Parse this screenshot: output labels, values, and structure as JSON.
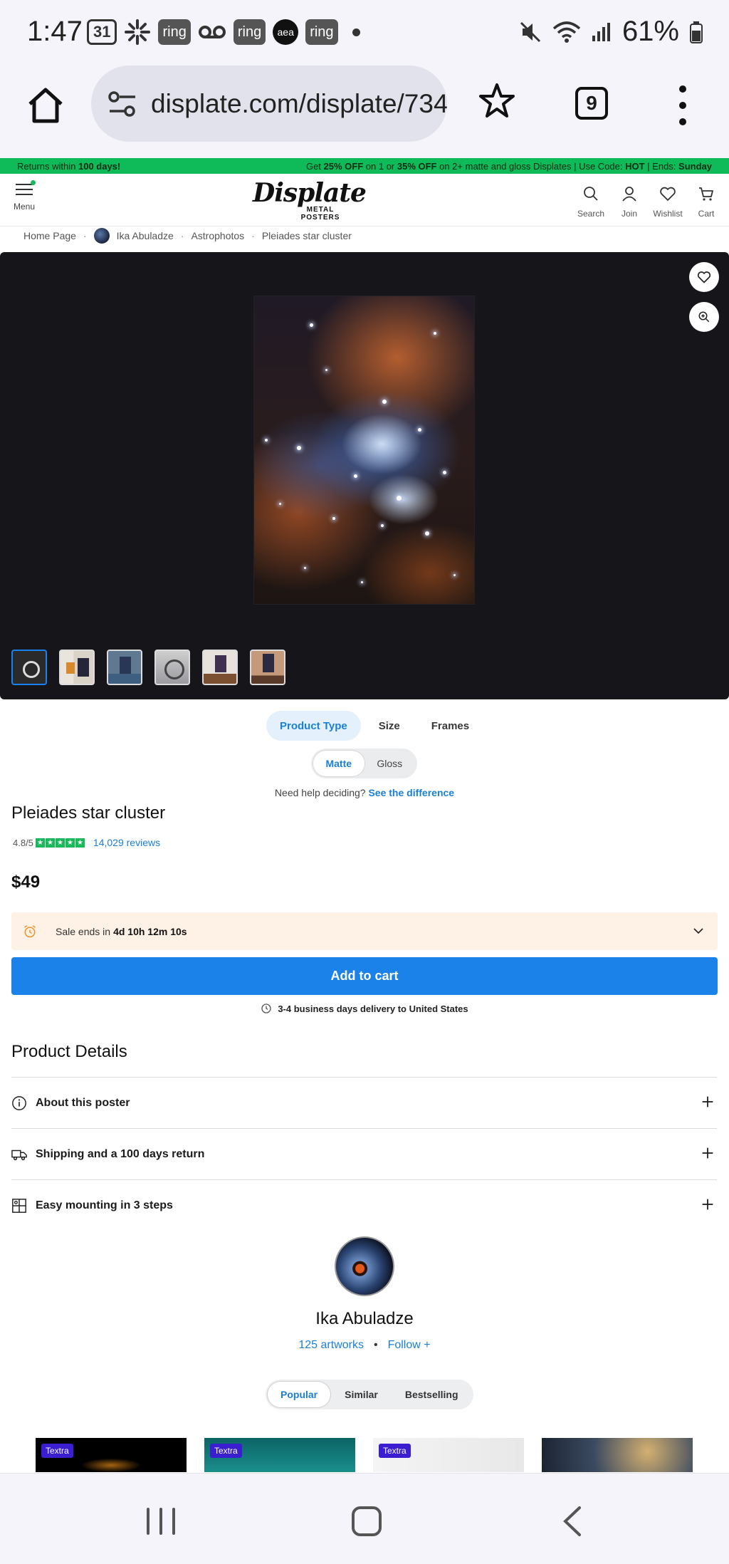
{
  "status_bar": {
    "time": "1:47",
    "calendar_day": "31",
    "left_icons": [
      "calendar-icon",
      "pinwheel-icon",
      "ring-icon",
      "voicemail-icon",
      "ring-icon",
      "amazon-icon",
      "ring-icon",
      "dot-icon"
    ],
    "ring_label": "ring",
    "amazon_label": "aea",
    "battery": "61%"
  },
  "browser": {
    "url": "displate.com/displate/734",
    "tab_count": "9"
  },
  "promo": {
    "left_prefix": "Returns within ",
    "left_bold": "100 days!",
    "right_1": "Get ",
    "right_2": "25% OFF",
    "right_3": " on 1 or ",
    "right_4": "35% OFF",
    "right_5": " on 2+ matte and gloss Displates | Use Code: ",
    "right_6": "HOT",
    "right_7": " | Ends: ",
    "right_8": "Sunday"
  },
  "header": {
    "menu_label": "Menu",
    "logo_text": "Displate",
    "logo_sub": "METAL POSTERS",
    "actions": {
      "search": "Search",
      "join": "Join",
      "wishlist": "Wishlist",
      "cart": "Cart"
    }
  },
  "breadcrumb": {
    "home": "Home Page",
    "artist": "Ika Abuladze",
    "category": "Astrophotos",
    "current": "Pleiades star cluster"
  },
  "options": {
    "tabs": [
      "Product Type",
      "Size",
      "Frames"
    ],
    "active_tab": "Product Type",
    "finishes": [
      "Matte",
      "Gloss"
    ],
    "active_finish": "Matte",
    "help_text": "Need help deciding? ",
    "help_link": "See the difference"
  },
  "product": {
    "title": "Pleiades star cluster",
    "rating": "4.8/5",
    "star_count": 5,
    "reviews": "14,029 reviews",
    "price": "$49",
    "sale_label": "Sale ends in",
    "sale_countdown": "4d 10h 12m 10s",
    "add_to_cart": "Add to cart",
    "delivery": "3-4 business days delivery to United States"
  },
  "details": {
    "title": "Product Details",
    "items": [
      "About this poster",
      "Shipping and a 100 days return",
      "Easy mounting in 3 steps"
    ]
  },
  "artist": {
    "name": "Ika Abuladze",
    "artworks": "125 artworks",
    "dot": "•",
    "follow": "Follow +",
    "tabs": [
      "Popular",
      "Similar",
      "Bestselling"
    ],
    "active_tab": "Popular",
    "card_tag": "Textra"
  },
  "colors": {
    "accent_blue": "#1a82e8",
    "promo_green": "#0fbb58",
    "rating_green": "#19b85a",
    "sale_bg": "#fef2e6",
    "textra_purple": "#3b1ecf"
  }
}
